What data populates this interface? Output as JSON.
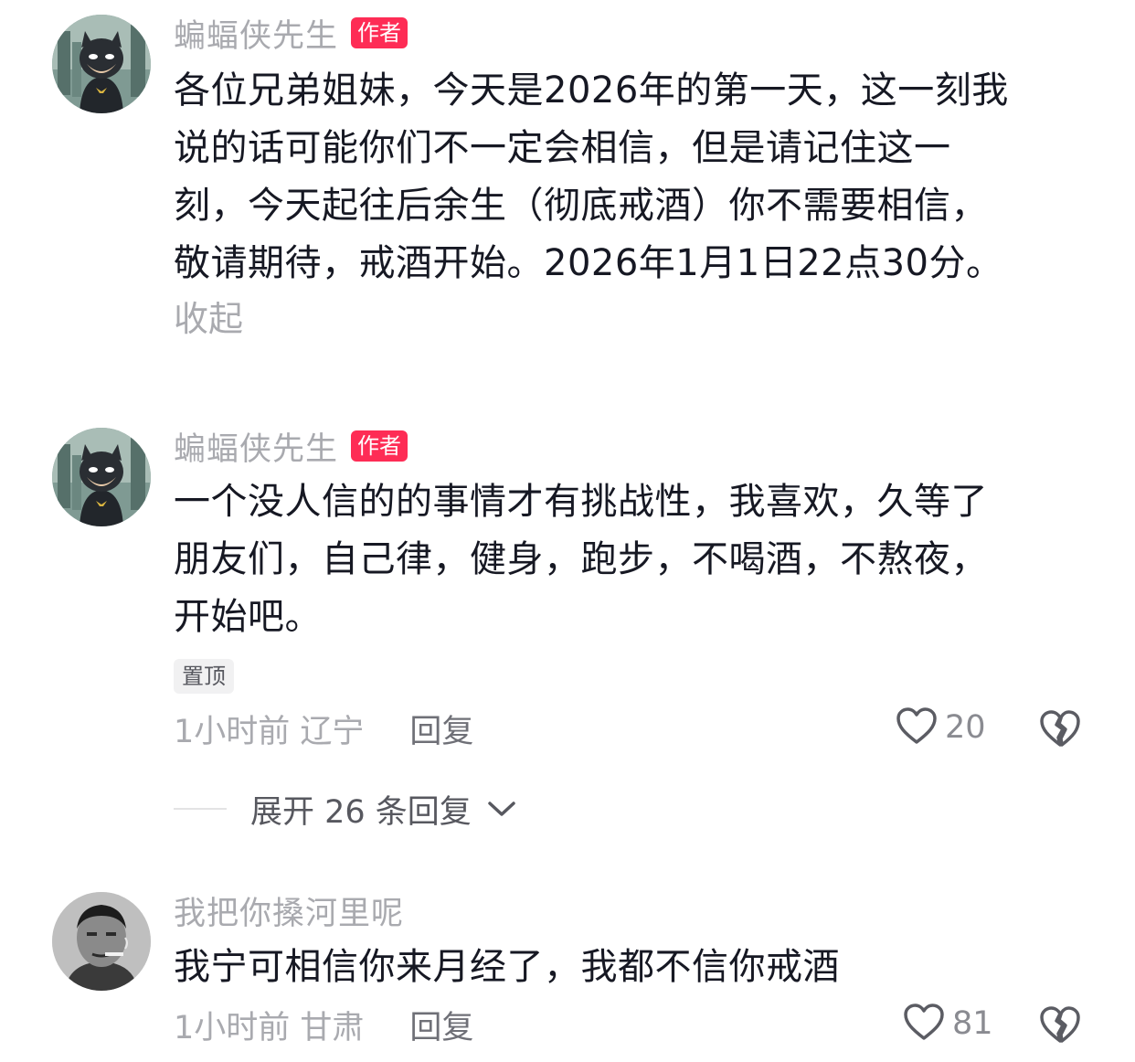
{
  "comments": [
    {
      "username": "蝙蝠侠先生",
      "badge": "作者",
      "lines": [
        "各位兄弟姐妹，今天是2026年的第一天，这一刻我",
        "说的话可能你们不一定会相信，但是请记住这一",
        "刻，今天起往后余生（彻底戒酒）你不需要相信，",
        "敬请期待，戒酒开始。2026年1月1日22点30分。"
      ],
      "collapse_label": "收起",
      "avatar_icon": "batman-avatar"
    },
    {
      "username": "蝙蝠侠先生",
      "badge": "作者",
      "lines": [
        "一个没人信的的事情才有挑战性，我喜欢，久等了",
        "朋友们，自己律，健身，跑步，不喝酒，不熬夜，",
        "开始吧。"
      ],
      "pin_label": "置顶",
      "time_location": "1小时前 辽宁",
      "reply_label": "回复",
      "like_count": "20",
      "avatar_icon": "batman-avatar"
    },
    {
      "username": "我把你搡河里呢",
      "lines": [
        "我宁可相信你来月经了，我都不信你戒酒"
      ],
      "time_location": "1小时前 甘肃",
      "reply_label": "回复",
      "like_count": "81",
      "avatar_icon": "man-smoking-avatar"
    }
  ],
  "expand_replies": {
    "label": "展开 26 条回复",
    "icon": "chevron-down-icon"
  },
  "icons": {
    "like": "heart-outline-icon",
    "dislike": "broken-heart-icon"
  },
  "colors": {
    "author_badge": "#fe2c55",
    "secondary_text": "#a9aaaf",
    "primary_text": "#161823"
  }
}
